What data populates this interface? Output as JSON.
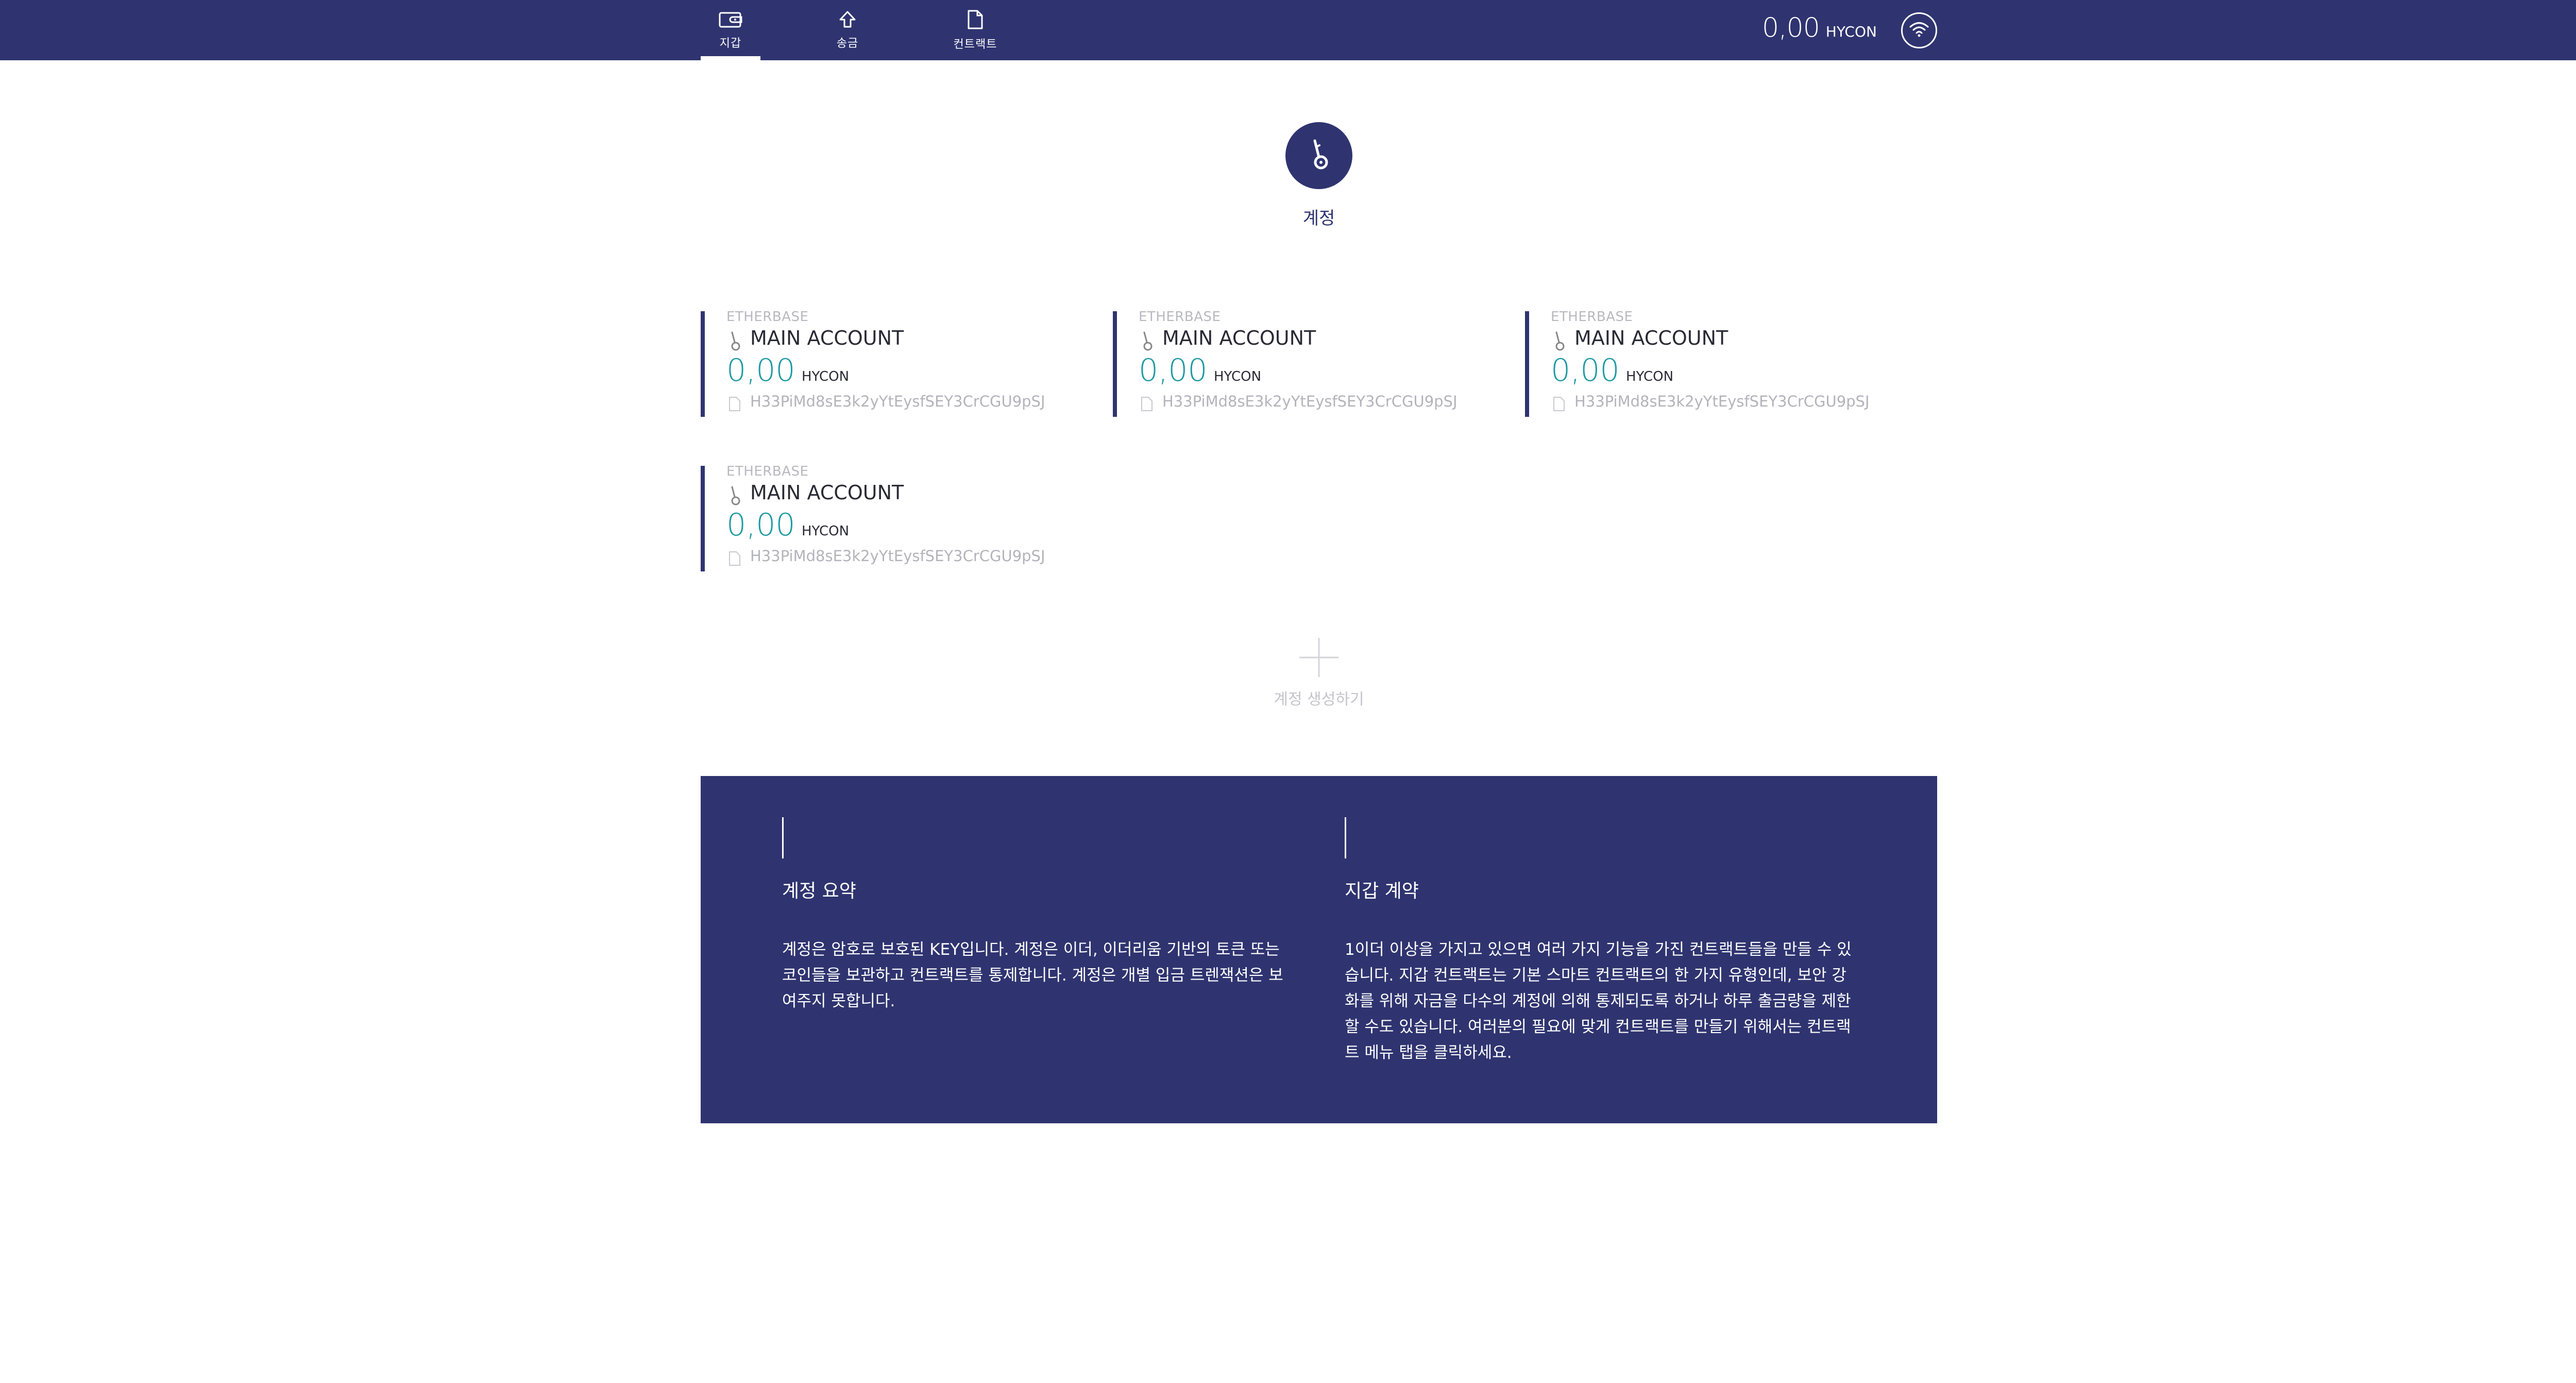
{
  "nav": {
    "tabs": [
      {
        "label": "지갑",
        "icon": "wallet-icon",
        "active": true
      },
      {
        "label": "송금",
        "icon": "send-arrow-icon",
        "active": false
      },
      {
        "label": "컨트랙트",
        "icon": "document-icon",
        "active": false
      }
    ],
    "balance_amount": "0,00",
    "balance_unit": "HYCON",
    "network_icon": "wifi-icon"
  },
  "header": {
    "icon": "key-icon",
    "title": "계정"
  },
  "accounts": [
    {
      "badge": "ETHERBASE",
      "name": "MAIN ACCOUNT",
      "amount": "0,00",
      "unit": "HYCON",
      "address": "H33PiMd8sE3k2yYtEysfSEY3CrCGU9pSJ"
    },
    {
      "badge": "ETHERBASE",
      "name": "MAIN ACCOUNT",
      "amount": "0,00",
      "unit": "HYCON",
      "address": "H33PiMd8sE3k2yYtEysfSEY3CrCGU9pSJ"
    },
    {
      "badge": "ETHERBASE",
      "name": "MAIN ACCOUNT",
      "amount": "0,00",
      "unit": "HYCON",
      "address": "H33PiMd8sE3k2yYtEysfSEY3CrCGU9pSJ"
    },
    {
      "badge": "ETHERBASE",
      "name": "MAIN ACCOUNT",
      "amount": "0,00",
      "unit": "HYCON",
      "address": "H33PiMd8sE3k2yYtEysfSEY3CrCGU9pSJ"
    }
  ],
  "create_account": {
    "icon": "plus-icon",
    "label": "계정 생성하기"
  },
  "info": {
    "left": {
      "title": "계정 요약",
      "body": "계정은 암호로 보호된 KEY입니다. 계정은 이더, 이더리움 기반의 토큰 또는 코인들을 보관하고 컨트랙트를 통제합니다. 계정은 개별 입금 트렌잭션은 보여주지 못합니다."
    },
    "right": {
      "title": "지갑 계약",
      "body": "1이더 이상을 가지고 있으면 여러 가지 기능을 가진 컨트랙트들을 만들 수 있습니다. 지갑 컨트랙트는 기본 스마트 컨트랙트의 한 가지 유형인데, 보안 강화를 위해 자금을 다수의 계정에 의해 통제되도록 하거나 하루 출금량을 제한할 수도 있습니다. 여러분의 필요에 맞게 컨트랙트를 만들기 위해서는 컨트랙트 메뉴 탭을 클릭하세요."
    }
  },
  "colors": {
    "primary": "#2f3470",
    "amount": "#1e9aa3",
    "muted": "#b3b3bb"
  }
}
